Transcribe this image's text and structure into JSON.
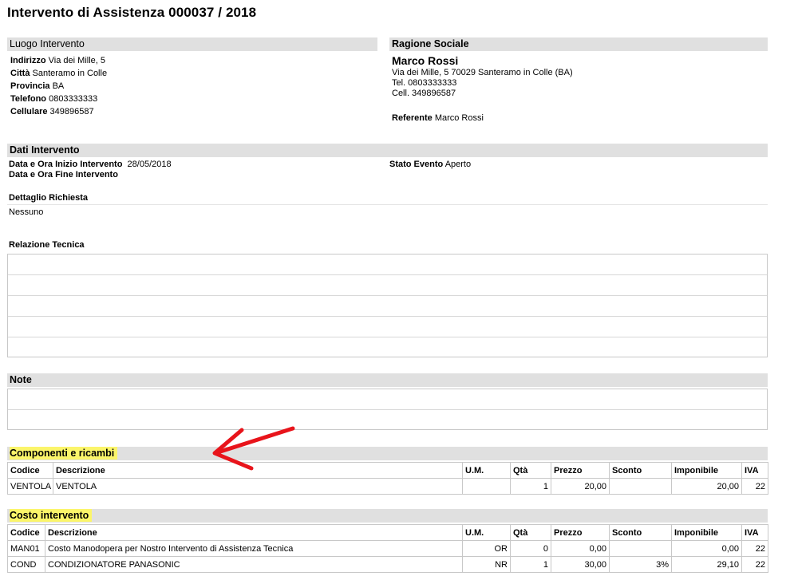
{
  "title": "Intervento di Assistenza 000037 / 2018",
  "luogo": {
    "header": "Luogo Intervento",
    "fields": [
      {
        "label": "Indirizzo",
        "value": "Via dei Mille, 5"
      },
      {
        "label": "Città",
        "value": "Santeramo in Colle"
      },
      {
        "label": "Provincia",
        "value": "BA"
      },
      {
        "label": "Telefono",
        "value": "0803333333"
      },
      {
        "label": "Cellulare",
        "value": "349896587"
      }
    ]
  },
  "ragione": {
    "header": "Ragione Sociale",
    "name": "Marco Rossi",
    "address": "Via dei Mille, 5 70029 Santeramo in Colle (BA)",
    "tel": "Tel. 0803333333",
    "cell": "Cell. 349896587",
    "referente_label": "Referente",
    "referente_value": "Marco Rossi"
  },
  "dati": {
    "header": "Dati Intervento",
    "inizio_label": "Data e Ora Inizio Intervento",
    "inizio_value": "28/05/2018",
    "fine_label": "Data e Ora Fine Intervento",
    "stato_label": "Stato Evento",
    "stato_value": "Aperto",
    "dettaglio_label": "Dettaglio Richiesta",
    "dettaglio_value": "Nessuno",
    "relazione_label": "Relazione Tecnica"
  },
  "note": {
    "header": "Note"
  },
  "columns": {
    "codice": "Codice",
    "descrizione": "Descrizione",
    "um": "U.M.",
    "qta": "Qtà",
    "prezzo": "Prezzo",
    "sconto": "Sconto",
    "imponibile": "Imponibile",
    "iva": "IVA"
  },
  "componenti": {
    "header": "Componenti e ricambi",
    "rows": [
      {
        "codice": "VENTOLA",
        "descrizione": "VENTOLA",
        "um": "",
        "qta": "1",
        "prezzo": "20,00",
        "sconto": "",
        "imponibile": "20,00",
        "iva": "22"
      }
    ]
  },
  "costo": {
    "header": "Costo intervento",
    "rows": [
      {
        "codice": "MAN01",
        "descrizione": "Costo Manodopera per Nostro Intervento di Assistenza Tecnica",
        "um": "OR",
        "qta": "0",
        "prezzo": "0,00",
        "sconto": "",
        "imponibile": "0,00",
        "iva": "22"
      },
      {
        "codice": "COND",
        "descrizione": "CONDIZIONATORE PANASONIC",
        "um": "NR",
        "qta": "1",
        "prezzo": "30,00",
        "sconto": "3%",
        "imponibile": "29,10",
        "iva": "22"
      }
    ]
  },
  "colors": {
    "header_bar": "#e0e0e0",
    "highlight": "#fbf56a",
    "arrow": "#e8141b"
  }
}
